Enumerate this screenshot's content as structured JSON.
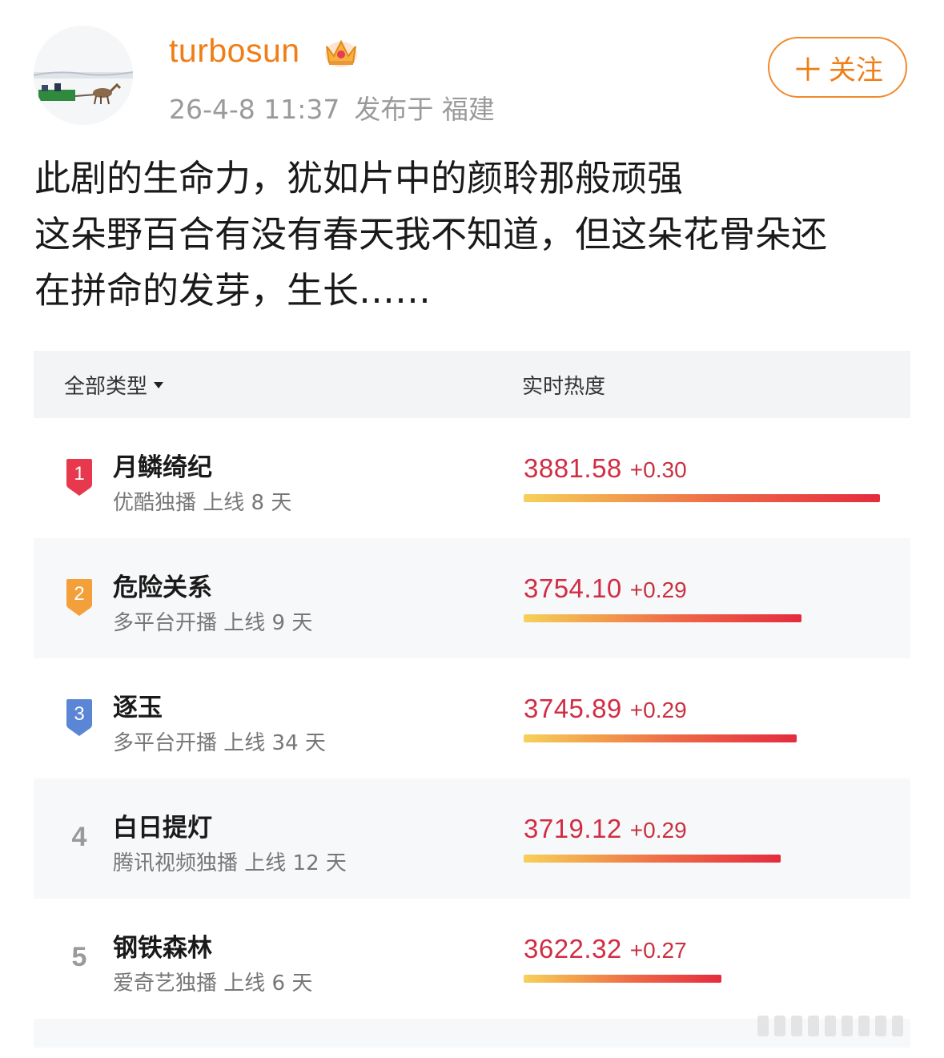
{
  "post": {
    "username": "turbosun",
    "date": "26-4-8 11:37",
    "location": "发布于 福建",
    "follow_label": "关注",
    "text_lines": [
      "此剧的生命力，犹如片中的颜聆那般顽强",
      "这朵野百合有没有春天我不知道，但这朵花骨朵还",
      "在拼命的发芽，生长……"
    ]
  },
  "ranking": {
    "filter_label": "全部类型",
    "heat_header": "实时热度",
    "bar_scale_max": 3881.58,
    "rows": [
      {
        "rank": "1",
        "name": "月鳞绮纪",
        "info": "优酷独播 上线 8 天",
        "heat": "3881.58",
        "delta": "+0.30",
        "badge_color": "#e8384d"
      },
      {
        "rank": "2",
        "name": "危险关系",
        "info": "多平台开播 上线 9 天",
        "heat": "3754.10",
        "delta": "+0.29",
        "badge_color": "#f4a03a"
      },
      {
        "rank": "3",
        "name": "逐玉",
        "info": "多平台开播 上线 34 天",
        "heat": "3745.89",
        "delta": "+0.29",
        "badge_color": "#5b86d6"
      },
      {
        "rank": "4",
        "name": "白日提灯",
        "info": "腾讯视频独播 上线 12 天",
        "heat": "3719.12",
        "delta": "+0.29",
        "badge_color": ""
      },
      {
        "rank": "5",
        "name": "钢铁森林",
        "info": "爱奇艺独播 上线 6 天",
        "heat": "3622.32",
        "delta": "+0.27",
        "badge_color": ""
      }
    ]
  }
}
